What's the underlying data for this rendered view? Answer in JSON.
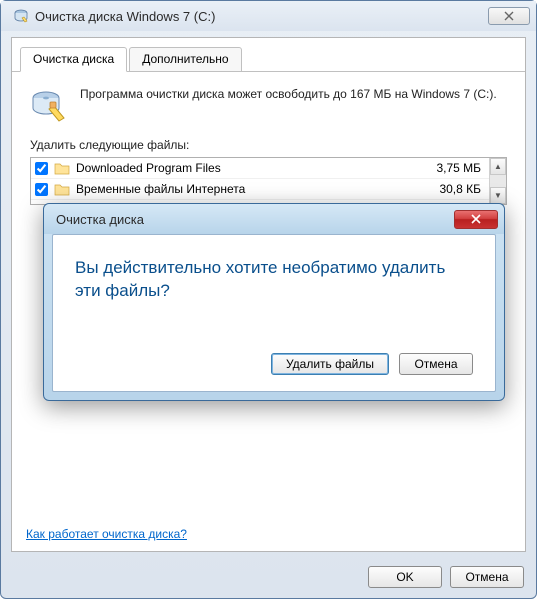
{
  "window": {
    "title": "Очистка диска Windows 7 (C:)"
  },
  "tabs": {
    "disk_cleanup": "Очистка диска",
    "more": "Дополнительно"
  },
  "info_text": "Программа очистки диска может освободить до 167 МБ на Windows 7 (C:).",
  "delete_label": "Удалить следующие файлы:",
  "files": [
    {
      "name": "Downloaded Program Files",
      "size": "3,75 МБ",
      "checked": true
    },
    {
      "name": "Временные файлы Интернета",
      "size": "30,8 КБ",
      "checked": true
    }
  ],
  "help_link": "Как работает очистка диска?",
  "buttons": {
    "ok": "OK",
    "cancel": "Отмена"
  },
  "dialog": {
    "title": "Очистка диска",
    "message": "Вы действительно хотите необратимо удалить эти файлы?",
    "delete": "Удалить файлы",
    "cancel": "Отмена"
  }
}
